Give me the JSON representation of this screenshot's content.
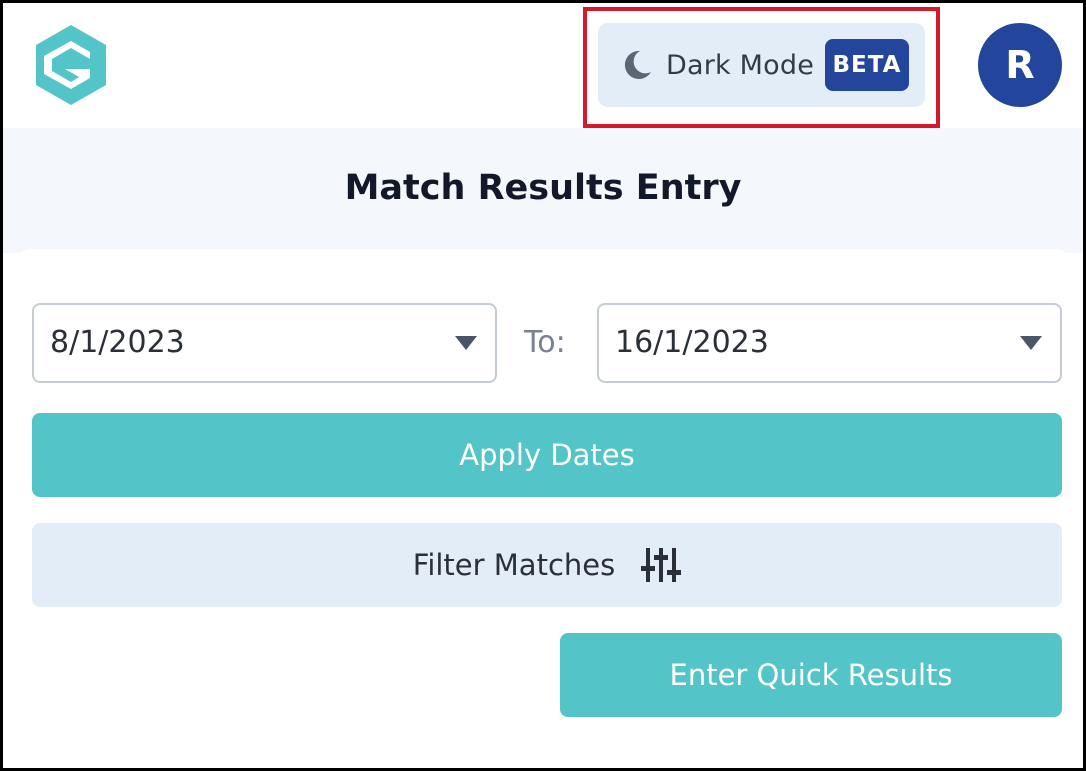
{
  "header": {
    "dark_mode_label": "Dark Mode",
    "beta_badge": "BETA",
    "avatar_initial": "R"
  },
  "page": {
    "title": "Match Results Entry"
  },
  "date_range": {
    "from_value": "8/1/2023",
    "to_label": "To:",
    "to_value": "16/1/2023"
  },
  "actions": {
    "apply_dates": "Apply Dates",
    "filter_matches": "Filter Matches",
    "enter_quick_results": "Enter Quick Results"
  },
  "icons": {
    "logo": "g-hexagon-logo",
    "dark_mode": "moon-icon",
    "caret": "chevron-down-icon",
    "filter": "sliders-icon"
  },
  "colors": {
    "teal": "#53c5c8",
    "navy": "#23459b",
    "light_blue": "#e3edf7",
    "highlight_red": "#d6182a"
  }
}
